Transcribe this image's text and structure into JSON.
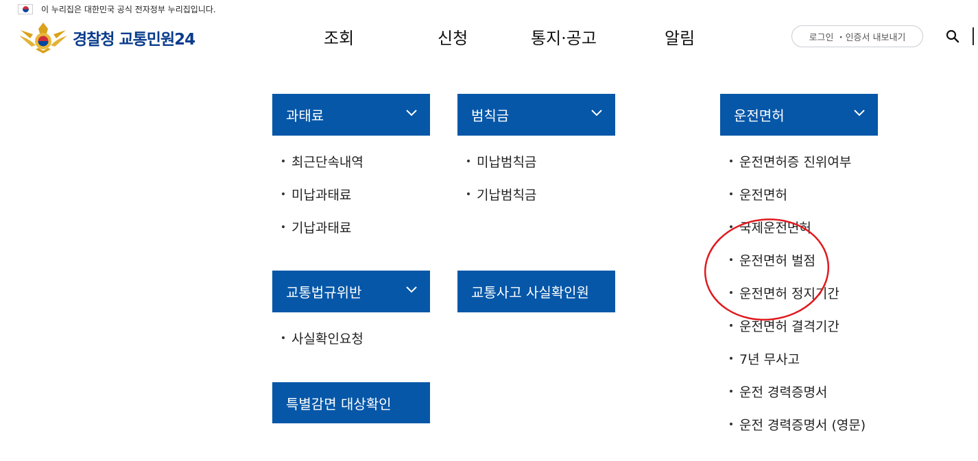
{
  "banner": {
    "text": "이 누리집은 대한민국 공식 전자정부 누리집입니다."
  },
  "logo": {
    "text": "경찰청 교통민원24"
  },
  "nav": {
    "items": [
      "조회",
      "신청",
      "통지·공고",
      "알림"
    ]
  },
  "header": {
    "login_label": "로그인 ・인증서 내보내기"
  },
  "menus": {
    "fine": {
      "title": "과태료",
      "items": [
        "최근단속내역",
        "미납과태료",
        "기납과태료"
      ]
    },
    "penalty": {
      "title": "범칙금",
      "items": [
        "미납범칙금",
        "기납범칙금"
      ]
    },
    "license": {
      "title": "운전면허",
      "items": [
        "운전면허증 진위여부",
        "운전면허",
        "국제운전면허",
        "운전면허 벌점",
        "운전면허 정지기간",
        "운전면허 결격기간",
        "7년 무사고",
        "운전 경력증명서",
        "운전 경력증명서 (영문)"
      ]
    },
    "violation": {
      "title": "교통법규위반",
      "items": [
        "사실확인요청"
      ]
    },
    "accident": {
      "title": "교통사고 사실확인원"
    },
    "special": {
      "title": "특별감면 대상확인"
    }
  },
  "colors": {
    "menu_bg": "#0657a8",
    "logo_text": "#0a3c8c",
    "annotation": "#e0191e"
  }
}
